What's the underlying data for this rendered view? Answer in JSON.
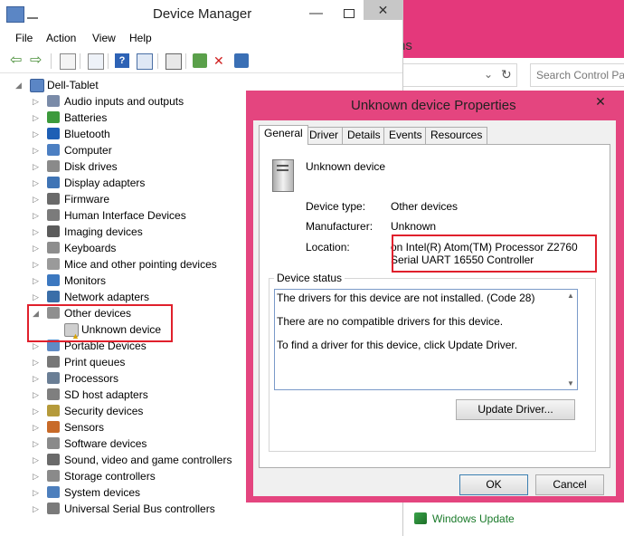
{
  "control_panel": {
    "title_fragment": "ns",
    "search_placeholder": "Search Control Par",
    "windows_update": "Windows Update"
  },
  "device_manager": {
    "title": "Device Manager",
    "window_buttons": {
      "minimize": "—",
      "close": "✕"
    },
    "menu": [
      "File",
      "Action",
      "View",
      "Help"
    ],
    "root": "Dell-Tablet",
    "categories": [
      {
        "label": "Audio inputs and outputs",
        "icon": "speaker-icon",
        "color": "#7a8ba8"
      },
      {
        "label": "Batteries",
        "icon": "battery-icon",
        "color": "#3c9a3c"
      },
      {
        "label": "Bluetooth",
        "icon": "bluetooth-icon",
        "color": "#1e5fb5"
      },
      {
        "label": "Computer",
        "icon": "computer-icon",
        "color": "#4c7fc2"
      },
      {
        "label": "Disk drives",
        "icon": "disk-drive-icon",
        "color": "#8a8a8a"
      },
      {
        "label": "Display adapters",
        "icon": "display-adapter-icon",
        "color": "#3f74b5"
      },
      {
        "label": "Firmware",
        "icon": "firmware-icon",
        "color": "#6a6a6a"
      },
      {
        "label": "Human Interface Devices",
        "icon": "hid-icon",
        "color": "#7b7b7b"
      },
      {
        "label": "Imaging devices",
        "icon": "camera-icon",
        "color": "#5b5b5b"
      },
      {
        "label": "Keyboards",
        "icon": "keyboard-icon",
        "color": "#8d8d8d"
      },
      {
        "label": "Mice and other pointing devices",
        "icon": "mouse-icon",
        "color": "#9a9a9a"
      },
      {
        "label": "Monitors",
        "icon": "monitor-icon",
        "color": "#3c78c0"
      },
      {
        "label": "Network adapters",
        "icon": "network-adapter-icon",
        "color": "#3a6ea8"
      },
      {
        "label": "Other devices",
        "icon": "other-devices-icon",
        "color": "#8f8f8f",
        "expanded": true
      },
      {
        "label": "Portable Devices",
        "icon": "portable-device-icon",
        "color": "#5f8ac5"
      },
      {
        "label": "Print queues",
        "icon": "printer-icon",
        "color": "#777777"
      },
      {
        "label": "Processors",
        "icon": "processor-icon",
        "color": "#6a7e95"
      },
      {
        "label": "SD host adapters",
        "icon": "sd-card-icon",
        "color": "#7f7f7f"
      },
      {
        "label": "Security devices",
        "icon": "security-icon",
        "color": "#b59a3a"
      },
      {
        "label": "Sensors",
        "icon": "sensor-icon",
        "color": "#c86a28"
      },
      {
        "label": "Software devices",
        "icon": "software-device-icon",
        "color": "#8a8a8a"
      },
      {
        "label": "Sound, video and game controllers",
        "icon": "sound-icon",
        "color": "#6a6a6a"
      },
      {
        "label": "Storage controllers",
        "icon": "storage-controller-icon",
        "color": "#8a8a8a"
      },
      {
        "label": "System devices",
        "icon": "system-device-icon",
        "color": "#4d7fbd"
      },
      {
        "label": "Universal Serial Bus controllers",
        "icon": "usb-icon",
        "color": "#7a7a7a"
      }
    ],
    "unknown_device": "Unknown device"
  },
  "properties": {
    "title": "Unknown device Properties",
    "close": "✕",
    "tabs": [
      "General",
      "Driver",
      "Details",
      "Events",
      "Resources"
    ],
    "device_name": "Unknown device",
    "device_type_label": "Device type:",
    "device_type": "Other devices",
    "manufacturer_label": "Manufacturer:",
    "manufacturer": "Unknown",
    "location_label": "Location:",
    "location": "on Intel(R) Atom(TM) Processor Z2760 Serial UART 16550 Controller",
    "status_group": "Device status",
    "status_lines": [
      "The drivers for this device are not installed. (Code 28)",
      "There are no compatible drivers for this device.",
      "To find a driver for this device, click Update Driver."
    ],
    "update_driver": "Update Driver...",
    "ok": "OK",
    "cancel": "Cancel"
  }
}
